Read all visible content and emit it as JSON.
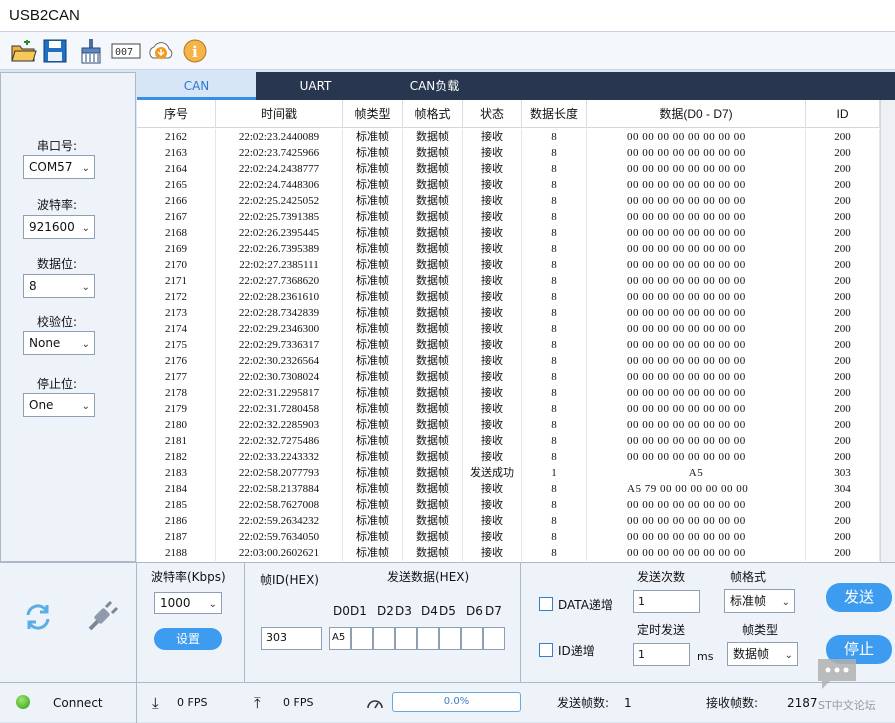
{
  "window": {
    "title": "USB2CAN"
  },
  "toolbar": {
    "icons": [
      "open-folder-icon",
      "save-icon",
      "clear-icon",
      "counter-icon",
      "download-cloud-icon",
      "info-icon"
    ]
  },
  "serial": {
    "port_label": "串口号:",
    "port_value": "COM57",
    "baud_label": "波特率:",
    "baud_value": "921600",
    "databits_label": "数据位:",
    "databits_value": "8",
    "parity_label": "校验位:",
    "parity_value": "None",
    "stopbits_label": "停止位:",
    "stopbits_value": "One"
  },
  "tabs": [
    {
      "label": "CAN",
      "active": true
    },
    {
      "label": "UART",
      "active": false
    },
    {
      "label": "CAN负载",
      "active": false
    }
  ],
  "table": {
    "headers": [
      "序号",
      "时间戳",
      "帧类型",
      "帧格式",
      "状态",
      "数据长度",
      "数据(D0 - D7)",
      "ID"
    ],
    "rows": [
      [
        "2162",
        "22:02:23.2440089",
        "标准帧",
        "数据帧",
        "接收",
        "8",
        "00 00 00 00 00 00 00 00",
        "200"
      ],
      [
        "2163",
        "22:02:23.7425966",
        "标准帧",
        "数据帧",
        "接收",
        "8",
        "00 00 00 00 00 00 00 00",
        "200"
      ],
      [
        "2164",
        "22:02:24.2438777",
        "标准帧",
        "数据帧",
        "接收",
        "8",
        "00 00 00 00 00 00 00 00",
        "200"
      ],
      [
        "2165",
        "22:02:24.7448306",
        "标准帧",
        "数据帧",
        "接收",
        "8",
        "00 00 00 00 00 00 00 00",
        "200"
      ],
      [
        "2166",
        "22:02:25.2425052",
        "标准帧",
        "数据帧",
        "接收",
        "8",
        "00 00 00 00 00 00 00 00",
        "200"
      ],
      [
        "2167",
        "22:02:25.7391385",
        "标准帧",
        "数据帧",
        "接收",
        "8",
        "00 00 00 00 00 00 00 00",
        "200"
      ],
      [
        "2168",
        "22:02:26.2395445",
        "标准帧",
        "数据帧",
        "接收",
        "8",
        "00 00 00 00 00 00 00 00",
        "200"
      ],
      [
        "2169",
        "22:02:26.7395389",
        "标准帧",
        "数据帧",
        "接收",
        "8",
        "00 00 00 00 00 00 00 00",
        "200"
      ],
      [
        "2170",
        "22:02:27.2385111",
        "标准帧",
        "数据帧",
        "接收",
        "8",
        "00 00 00 00 00 00 00 00",
        "200"
      ],
      [
        "2171",
        "22:02:27.7368620",
        "标准帧",
        "数据帧",
        "接收",
        "8",
        "00 00 00 00 00 00 00 00",
        "200"
      ],
      [
        "2172",
        "22:02:28.2361610",
        "标准帧",
        "数据帧",
        "接收",
        "8",
        "00 00 00 00 00 00 00 00",
        "200"
      ],
      [
        "2173",
        "22:02:28.7342839",
        "标准帧",
        "数据帧",
        "接收",
        "8",
        "00 00 00 00 00 00 00 00",
        "200"
      ],
      [
        "2174",
        "22:02:29.2346300",
        "标准帧",
        "数据帧",
        "接收",
        "8",
        "00 00 00 00 00 00 00 00",
        "200"
      ],
      [
        "2175",
        "22:02:29.7336317",
        "标准帧",
        "数据帧",
        "接收",
        "8",
        "00 00 00 00 00 00 00 00",
        "200"
      ],
      [
        "2176",
        "22:02:30.2326564",
        "标准帧",
        "数据帧",
        "接收",
        "8",
        "00 00 00 00 00 00 00 00",
        "200"
      ],
      [
        "2177",
        "22:02:30.7308024",
        "标准帧",
        "数据帧",
        "接收",
        "8",
        "00 00 00 00 00 00 00 00",
        "200"
      ],
      [
        "2178",
        "22:02:31.2295817",
        "标准帧",
        "数据帧",
        "接收",
        "8",
        "00 00 00 00 00 00 00 00",
        "200"
      ],
      [
        "2179",
        "22:02:31.7280458",
        "标准帧",
        "数据帧",
        "接收",
        "8",
        "00 00 00 00 00 00 00 00",
        "200"
      ],
      [
        "2180",
        "22:02:32.2285903",
        "标准帧",
        "数据帧",
        "接收",
        "8",
        "00 00 00 00 00 00 00 00",
        "200"
      ],
      [
        "2181",
        "22:02:32.7275486",
        "标准帧",
        "数据帧",
        "接收",
        "8",
        "00 00 00 00 00 00 00 00",
        "200"
      ],
      [
        "2182",
        "22:02:33.2243332",
        "标准帧",
        "数据帧",
        "接收",
        "8",
        "00 00 00 00 00 00 00 00",
        "200"
      ],
      [
        "2183",
        "22:02:58.2077793",
        "标准帧",
        "数据帧",
        "发送成功",
        "1",
        "A5",
        "303"
      ],
      [
        "2184",
        "22:02:58.2137884",
        "标准帧",
        "数据帧",
        "接收",
        "8",
        "A5 79 00 00 00 00 00 00",
        "304"
      ],
      [
        "2185",
        "22:02:58.7627008",
        "标准帧",
        "数据帧",
        "接收",
        "8",
        "00 00 00 00 00 00 00 00",
        "200"
      ],
      [
        "2186",
        "22:02:59.2634232",
        "标准帧",
        "数据帧",
        "接收",
        "8",
        "00 00 00 00 00 00 00 00",
        "200"
      ],
      [
        "2187",
        "22:02:59.7634050",
        "标准帧",
        "数据帧",
        "接收",
        "8",
        "00 00 00 00 00 00 00 00",
        "200"
      ],
      [
        "2188",
        "22:03:00.2602621",
        "标准帧",
        "数据帧",
        "接收",
        "8",
        "00 00 00 00 00 00 00 00",
        "200"
      ]
    ]
  },
  "can_settings": {
    "baud_label": "波特率(Kbps)",
    "baud_value": "1000",
    "set_button": "设置"
  },
  "send": {
    "frame_id_label": "帧ID(HEX)",
    "frame_id_value": "303",
    "data_label": "发送数据(HEX)",
    "byte_labels": [
      "D0",
      "D1",
      "D2",
      "D3",
      "D4",
      "D5",
      "D6",
      "D7"
    ],
    "byte_values": [
      "A5",
      "",
      "",
      "",
      "",
      "",
      "",
      ""
    ]
  },
  "options": {
    "data_inc_label": "DATA递增",
    "id_inc_label": "ID递增",
    "send_count_label": "发送次数",
    "send_count_value": "1",
    "timer_label": "定时发送",
    "timer_value": "1",
    "timer_unit": "ms",
    "frame_format_label": "帧格式",
    "frame_format_value": "标准帧",
    "frame_type_label": "帧类型",
    "frame_type_value": "数据帧",
    "send_button": "发送",
    "stop_button": "停止"
  },
  "status": {
    "connect_label": "Connect",
    "rx_fps": "0 FPS",
    "tx_fps": "0 FPS",
    "progress": "0.0%",
    "progress_fraction": 0.0,
    "sent_label": "发送帧数:",
    "sent_value": "1",
    "recv_label": "接收帧数:",
    "recv_value": "2187",
    "watermark": "ST中文论坛"
  }
}
